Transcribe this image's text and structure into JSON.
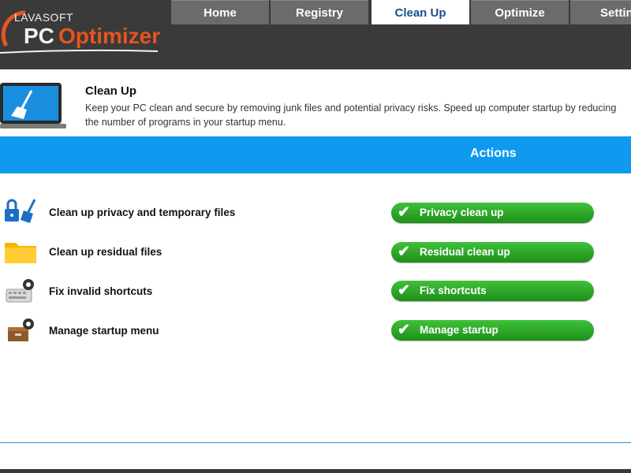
{
  "app": {
    "logo_brand": "LAVASOFT",
    "logo_pc": "PC",
    "logo_optimizer": "Optimizer",
    "info_icon": "i"
  },
  "tabs": [
    {
      "label": "Home"
    },
    {
      "label": "Registry"
    },
    {
      "label": "Clean Up"
    },
    {
      "label": "Optimize"
    },
    {
      "label": "Settings"
    }
  ],
  "header": {
    "title": "Clean Up",
    "description_line1": "Keep your PC clean and secure by removing junk files and potential privacy risks. Speed up computer startup by reducing",
    "description_line2": "the number of programs in your startup menu."
  },
  "actions": {
    "title": "Actions",
    "rows": [
      {
        "label": "Clean up privacy and temporary files",
        "button": "Privacy clean up",
        "icon": "lock-broom-icon"
      },
      {
        "label": "Clean up residual files",
        "button": "Residual clean up",
        "icon": "folder-icon"
      },
      {
        "label": "Fix invalid shortcuts",
        "button": "Fix shortcuts",
        "icon": "keyboard-gear-icon"
      },
      {
        "label": "Manage startup menu",
        "button": "Manage startup",
        "icon": "box-gear-icon"
      }
    ]
  },
  "colors": {
    "topbar": "#3a3a3a",
    "tab": "#6b6b6b",
    "accent_blue": "#0f9af0",
    "button_green": "#2aa625",
    "brand_orange": "#e8541e"
  }
}
